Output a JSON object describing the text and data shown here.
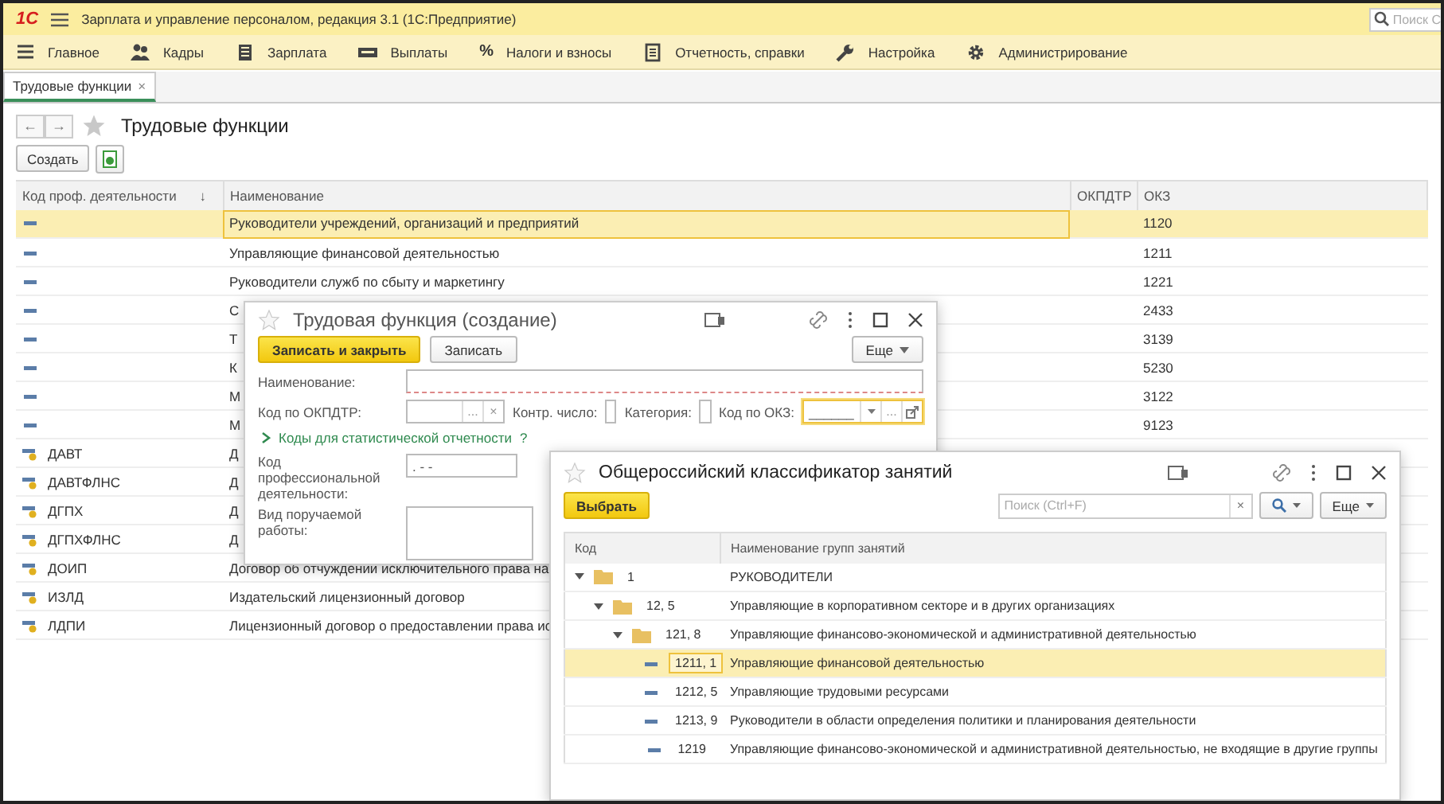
{
  "app": {
    "logo": "1С",
    "title": "Зарплата и управление персоналом, редакция 3.1  (1С:Предприятие)",
    "search_placeholder": "Поиск С"
  },
  "menu": [
    {
      "kind": "lines",
      "label": "Главное"
    },
    {
      "kind": "people",
      "label": "Кадры"
    },
    {
      "kind": "calc",
      "label": "Зарплата"
    },
    {
      "kind": "cash",
      "label": "Выплаты"
    },
    {
      "kind": "symbol",
      "symbol": "%",
      "label": "Налоги и взносы"
    },
    {
      "kind": "report",
      "label": "Отчетность, справки"
    },
    {
      "kind": "wrench",
      "label": "Настройка"
    },
    {
      "kind": "gear",
      "label": "Администрирование"
    }
  ],
  "open_tabs": [
    {
      "label": "Трудовые функции",
      "close": "×",
      "selected": true
    }
  ],
  "page": {
    "back": "←",
    "forward": "→",
    "title": "Трудовые функции",
    "create": "Создать"
  },
  "table": {
    "columns": [
      "Код проф. деятельности",
      "Наименование",
      "ОКПДТР",
      "ОКЗ"
    ],
    "sort_mark": "↓",
    "rows": [
      {
        "kind": "item",
        "name": "Руководители учреждений, организаций и предприятий",
        "okz": "1120",
        "selected": true
      },
      {
        "kind": "item",
        "name": "Управляющие финансовой деятельностью",
        "okz": "1211",
        "selected": false
      },
      {
        "kind": "item",
        "name": "Руководители служб по сбыту и маркетингу",
        "okz": "1221",
        "selected": false
      },
      {
        "kind": "item",
        "name": "С",
        "okz": "2433",
        "selected": false
      },
      {
        "kind": "item",
        "name": "Т",
        "okz": "3139",
        "selected": false
      },
      {
        "kind": "item",
        "name": "К",
        "okz": "5230",
        "selected": false
      },
      {
        "kind": "item",
        "name": "М",
        "okz": "3122",
        "selected": false
      },
      {
        "kind": "item",
        "name": "М",
        "okz": "9123",
        "selected": false
      },
      {
        "kind": "contract",
        "code": "ДАВТ",
        "name": "Д",
        "selected": false
      },
      {
        "kind": "contract",
        "code": "ДАВТФЛНС",
        "name": "Д",
        "selected": false
      },
      {
        "kind": "contract",
        "code": "ДГПХ",
        "name": "Д",
        "selected": false
      },
      {
        "kind": "contract",
        "code": "ДГПХФЛНС",
        "name": "Д",
        "selected": false
      },
      {
        "kind": "contract",
        "code": "ДОИП",
        "name": "Договор об отчуждении исключительного права на",
        "selected": false
      },
      {
        "kind": "contract",
        "code": "ИЗЛД",
        "name": "Издательский лицензионный договор",
        "selected": false
      },
      {
        "kind": "contract",
        "code": "ЛДПИ",
        "name": "Лицензионный договор о предоставлении права ис",
        "selected": false
      }
    ]
  },
  "form": {
    "title": "Трудовая функция (создание)",
    "buttons": [
      {
        "kind": "primary",
        "label": "Записать и закрыть"
      },
      {
        "kind": "normal",
        "label": "Записать"
      }
    ],
    "more": "Еще",
    "name_label": "Наименование:",
    "okpdtr_label": "Код по ОКПДТР:",
    "okpdtr_select": "...",
    "okpdtr_clear": "×",
    "check_label": "Контр. число:",
    "category_label": "Категория:",
    "okz_label": "Код по ОКЗ:",
    "okz_value": "______",
    "okz_select": "...",
    "group_link": "Коды для статистической отчетности",
    "group_expanded": false,
    "help": "?",
    "prof_label": "Код профессиональной деятельности:",
    "prof_value": ".  - -",
    "work_label": "Вид поручаемой работы:"
  },
  "okz": {
    "title": "Общероссийский классификатор занятий",
    "choose": "Выбрать",
    "search_placeholder": "Поиск (Ctrl+F)",
    "search_clear": "×",
    "more": "Еще",
    "columns": [
      "Код",
      "Наименование групп занятий"
    ],
    "tree": [
      {
        "kind": "group",
        "code": "1",
        "name": "РУКОВОДИТЕЛИ",
        "expanded": true,
        "selected": false,
        "children": [
          {
            "kind": "group",
            "code": "12, 5",
            "name": "Управляющие в корпоративном секторе и в других организациях",
            "expanded": true,
            "selected": false,
            "children": [
              {
                "kind": "group",
                "code": "121, 8",
                "name": "Управляющие финансово-экономической и административной деятельностью",
                "expanded": true,
                "selected": false,
                "children": [
                  {
                    "kind": "item",
                    "code": "1211, 1",
                    "name": "Управляющие финансовой деятельностью",
                    "selected": true
                  },
                  {
                    "kind": "item",
                    "code": "1212, 5",
                    "name": "Управляющие трудовыми ресурсами",
                    "selected": false
                  },
                  {
                    "kind": "item",
                    "code": "1213, 9",
                    "name": "Руководители в области определения политики и планирования деятельности",
                    "selected": false
                  },
                  {
                    "kind": "item",
                    "code": "1219",
                    "name": "Управляющие финансово-экономической и административной деятельностью, не входящие в другие группы",
                    "selected": false
                  }
                ]
              }
            ]
          }
        ]
      }
    ]
  }
}
